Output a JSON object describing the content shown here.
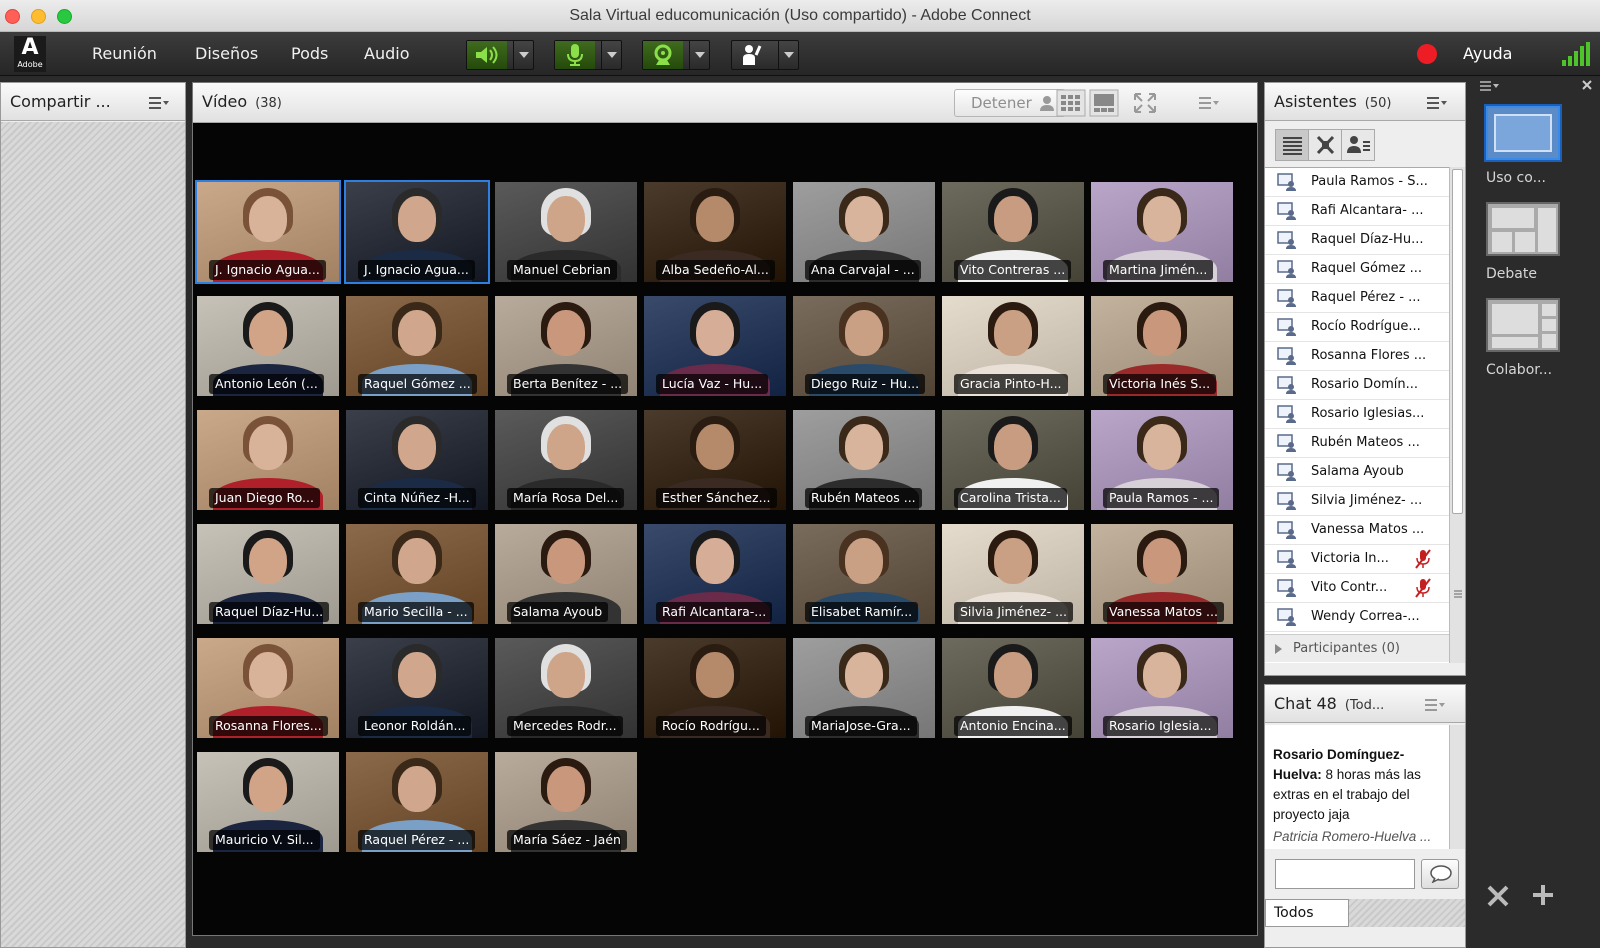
{
  "window": {
    "title": "Sala Virtual educomunicación (Uso compartido) - Adobe Connect"
  },
  "menubar": {
    "logo_letter": "A",
    "logo_text": "Adobe",
    "items": [
      "Reunión",
      "Diseños",
      "Pods",
      "Audio"
    ],
    "tools": [
      {
        "name": "speaker",
        "icon": "speaker-icon",
        "active": true
      },
      {
        "name": "microphone",
        "icon": "microphone-icon",
        "active": true
      },
      {
        "name": "camera",
        "icon": "webcam-icon",
        "active": true
      },
      {
        "name": "status",
        "icon": "raise-hand-icon",
        "active": false
      }
    ],
    "record_color": "#ee1c24",
    "help_label": "Ayuda"
  },
  "share_pod": {
    "title": "Compartir ..."
  },
  "video_pod": {
    "title": "Vídeo",
    "count": "(38)",
    "stop_label": "Detener",
    "tiles": [
      "J. Ignacio Agua...",
      "J. Ignacio Agua...",
      "Manuel Cebrian",
      "Alba Sedeño-Al...",
      "Ana Carvajal - ...",
      "Vito Contreras ...",
      "Martina Jimén...",
      "Antonio León (...",
      "Raquel Gómez ...",
      "Berta Benítez - ...",
      "Lucía Vaz - Hu...",
      "Diego Ruiz - Hu...",
      "Gracia Pinto-H...",
      "Victoria Inés S...",
      "Juan Diego Ro...",
      "Cinta Núñez -H...",
      "María Rosa Del...",
      "Esther Sánchez...",
      "Rubén Mateos ...",
      "Carolina Trista...",
      "Paula Ramos - ...",
      "Raquel Díaz-Hu...",
      "Mario Secilla - ...",
      "Salama Ayoub",
      "Rafi Alcantara-...",
      "Elisabet Ramír...",
      "Silvia Jiménez- ...",
      "Vanessa Matos ...",
      "Rosanna Flores...",
      "Leonor Roldán...",
      "Mercedes Rodr...",
      "Rocío Rodrígu...",
      "MariaJose-Gra...",
      "Antonio Encina...",
      "Rosario Iglesia...",
      "Mauricio V. Sil...",
      "Raquel Pérez - ...",
      "María Sáez - Jaén"
    ],
    "selected": [
      0,
      1
    ]
  },
  "attendees_pod": {
    "title": "Asistentes",
    "count": "(50)",
    "rows": [
      {
        "name": "Paula Ramos - S...",
        "mic_off": false
      },
      {
        "name": "Rafi Alcantara- ...",
        "mic_off": false
      },
      {
        "name": "Raquel Díaz-Hu...",
        "mic_off": false
      },
      {
        "name": "Raquel Gómez ...",
        "mic_off": false
      },
      {
        "name": "Raquel Pérez - ...",
        "mic_off": false
      },
      {
        "name": "Rocío Rodrígue...",
        "mic_off": false
      },
      {
        "name": "Rosanna Flores ...",
        "mic_off": false
      },
      {
        "name": "Rosario Domín...",
        "mic_off": false
      },
      {
        "name": "Rosario Iglesias...",
        "mic_off": false
      },
      {
        "name": "Rubén Mateos ...",
        "mic_off": false
      },
      {
        "name": "Salama Ayoub",
        "mic_off": false
      },
      {
        "name": "Silvia Jiménez- ...",
        "mic_off": false
      },
      {
        "name": "Vanessa Matos ...",
        "mic_off": false
      },
      {
        "name": "Victoria In...",
        "mic_off": true
      },
      {
        "name": "Vito Contr...",
        "mic_off": true
      },
      {
        "name": "Wendy Correa-...",
        "mic_off": false
      }
    ],
    "participants_label": "Participantes (0)"
  },
  "chat_pod": {
    "title": "Chat 48",
    "scope": "(Tod...",
    "message_author": "Rosario Domínguez-Huelva:",
    "message_text": " 8 horas más las extras en el trabajo del proyecto jaja",
    "typing": "Patricia Romero-Huelva ...",
    "recipient": "Todos"
  },
  "layouts": [
    {
      "label": "Uso co...",
      "selected": true
    },
    {
      "label": "Debate",
      "selected": false
    },
    {
      "label": "Colabor...",
      "selected": false
    }
  ]
}
